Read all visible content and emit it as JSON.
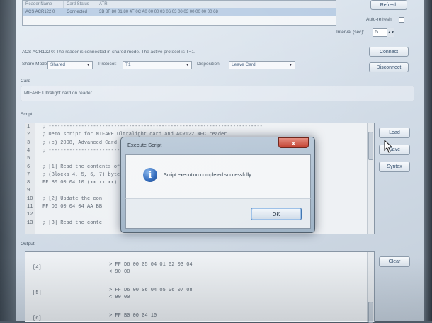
{
  "reader_list": {
    "columns": [
      "Reader Name",
      "Card Status",
      "ATR"
    ],
    "row": {
      "name": "ACS ACR122 0",
      "status": "Connected",
      "atr": "3B 8F 80 01 80 4F 0C A0 00 00 03 06 03 00 03 00 00 00 00 68"
    }
  },
  "buttons": {
    "refresh": "Refresh",
    "connect": "Connect",
    "disconnect": "Disconnect",
    "load": "Load",
    "save": "Save",
    "syntax": "Syntax",
    "clear": "Clear"
  },
  "auto_refresh_label": "Auto-refresh",
  "interval": {
    "label": "Interval (sec):",
    "value": "5"
  },
  "status_text": "ACS ACR122 0: The reader is connected in shared mode. The active protocol is T=1.",
  "share_mode": {
    "label": "Share Mode:",
    "value": "Shared"
  },
  "protocol": {
    "label": "Protocol:",
    "value": "T1"
  },
  "disposition": {
    "label": "Disposition:",
    "value": "Leave Card"
  },
  "card": {
    "label": "Card",
    "text": "MIFARE Ultralight card on reader."
  },
  "script": {
    "label": "Script",
    "lines": [
      {
        "n": "1",
        "code": "; ------------------------------------------------------------------------"
      },
      {
        "n": "2",
        "code": "; Demo script for MIFARE Ultralight card and ACR122 NFC reader"
      },
      {
        "n": "3",
        "code": "; (c) 2008, Advanced Card Systems Ltd."
      },
      {
        "n": "4",
        "code": "; ------------------------------------------------------------------------"
      },
      {
        "n": "5",
        "code": ""
      },
      {
        "n": "6",
        "code": "; [1] Read the contents of"
      },
      {
        "n": "7",
        "code": ";     (Blocks 4, 5, 6, 7)                                        bytes)"
      },
      {
        "n": "8",
        "code": "FF B0 00 04 10 (xx xx                                              xx)"
      },
      {
        "n": "9",
        "code": ""
      },
      {
        "n": "10",
        "code": "; [2] Update the con"
      },
      {
        "n": "11",
        "code": "FF D6 00 04 04 AA BB"
      },
      {
        "n": "12",
        "code": ""
      },
      {
        "n": "13",
        "code": "; [3] Read the conte"
      }
    ]
  },
  "output": {
    "label": "Output",
    "entries": [
      {
        "tag": "[4]",
        "cmd": "> FF D6 00 05 04 01 02 03 04",
        "resp": "< 90 00"
      },
      {
        "tag": "[5]",
        "cmd": "> FF D6 00 06 04 05 06 07 08",
        "resp": "< 90 00"
      },
      {
        "tag": "[6]",
        "cmd": "> FF B0 00 04 10",
        "resp": ""
      }
    ]
  },
  "dialog": {
    "title": "Execute Script",
    "close_glyph": "x",
    "icon_glyph": "i",
    "message": "Script execution completed successfully.",
    "ok": "OK"
  }
}
